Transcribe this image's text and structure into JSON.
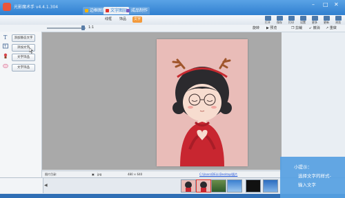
{
  "window": {
    "app_name": "光影魔术手 v4.4.1.304",
    "minimize": "–",
    "maximize": "□",
    "close": "✕"
  },
  "tabs": [
    {
      "label": "边框图层",
      "color": "#f6b400"
    },
    {
      "label": "文字图层",
      "color": "#e0322b"
    },
    {
      "label": "成品制作",
      "color": "#7a5cc0"
    }
  ],
  "subtabs": [
    {
      "label": "线框"
    },
    {
      "label": "饰品"
    },
    {
      "label": "文字"
    }
  ],
  "toolbar_buttons": [
    {
      "label": "打开"
    },
    {
      "label": "保存"
    },
    {
      "label": "打印"
    },
    {
      "label": "设置"
    },
    {
      "label": "更多"
    },
    {
      "label": "更新"
    },
    {
      "label": "浏览"
    }
  ],
  "view": {
    "ratio": "1:1",
    "rotate": "旋转",
    "zoom_level": 0.9
  },
  "secondary_buttons": [
    {
      "label": "▶ 预览"
    },
    {
      "label": "❐ 剪裁"
    },
    {
      "label": "↙ 撤消"
    },
    {
      "label": "↗ 重做"
    }
  ],
  "left_panel": {
    "buttons": [
      {
        "label": "添加静态文字"
      },
      {
        "label": "添加文字"
      },
      {
        "label": "文字饰品"
      },
      {
        "label": "文字饰品"
      }
    ]
  },
  "status": {
    "label": "图片目录:",
    "file_type": "jpg",
    "dimensions": "480 × 640",
    "path": "C:\\Users\\DELL\\Desktop\\图片"
  },
  "filmstrip": {
    "prev": "◀",
    "next": "▶"
  },
  "tip": {
    "title": "小提示：",
    "line1": "选择文字的样式-",
    "line2": "输入文字"
  },
  "colors": {
    "accent": "#2f7fd0",
    "active_subtab": "#f39a3b",
    "photo_bg": "#e9bcb8",
    "sweater": "#c82630",
    "tip_bg": "#56a0e2"
  }
}
